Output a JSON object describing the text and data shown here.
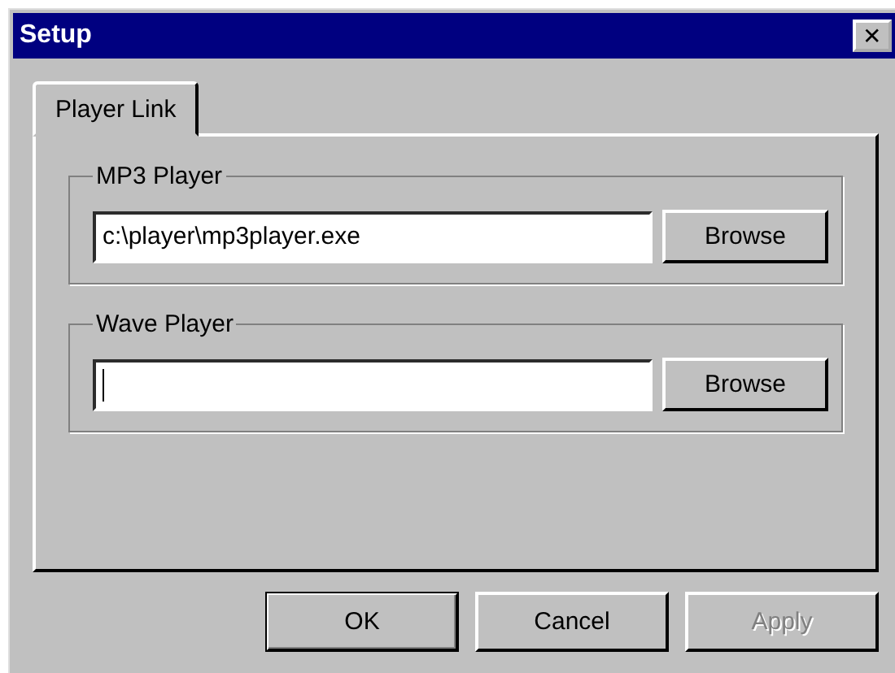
{
  "window": {
    "title": "Setup",
    "close": "✕"
  },
  "tabs": [
    {
      "label": "Player Link",
      "selected": true
    }
  ],
  "groups": [
    {
      "title": "MP3 Player",
      "field": {
        "value": "c:\\player\\mp3player.exe",
        "focused": false
      },
      "button": "Browse"
    },
    {
      "title": "Wave Player",
      "field": {
        "focused": true
      },
      "button": "Browse"
    }
  ],
  "buttons": [
    {
      "label": "OK",
      "default": true,
      "disabled": false
    },
    {
      "label": "Cancel",
      "default": false,
      "disabled": false
    },
    {
      "label": "Apply",
      "default": false,
      "disabled": true
    }
  ]
}
